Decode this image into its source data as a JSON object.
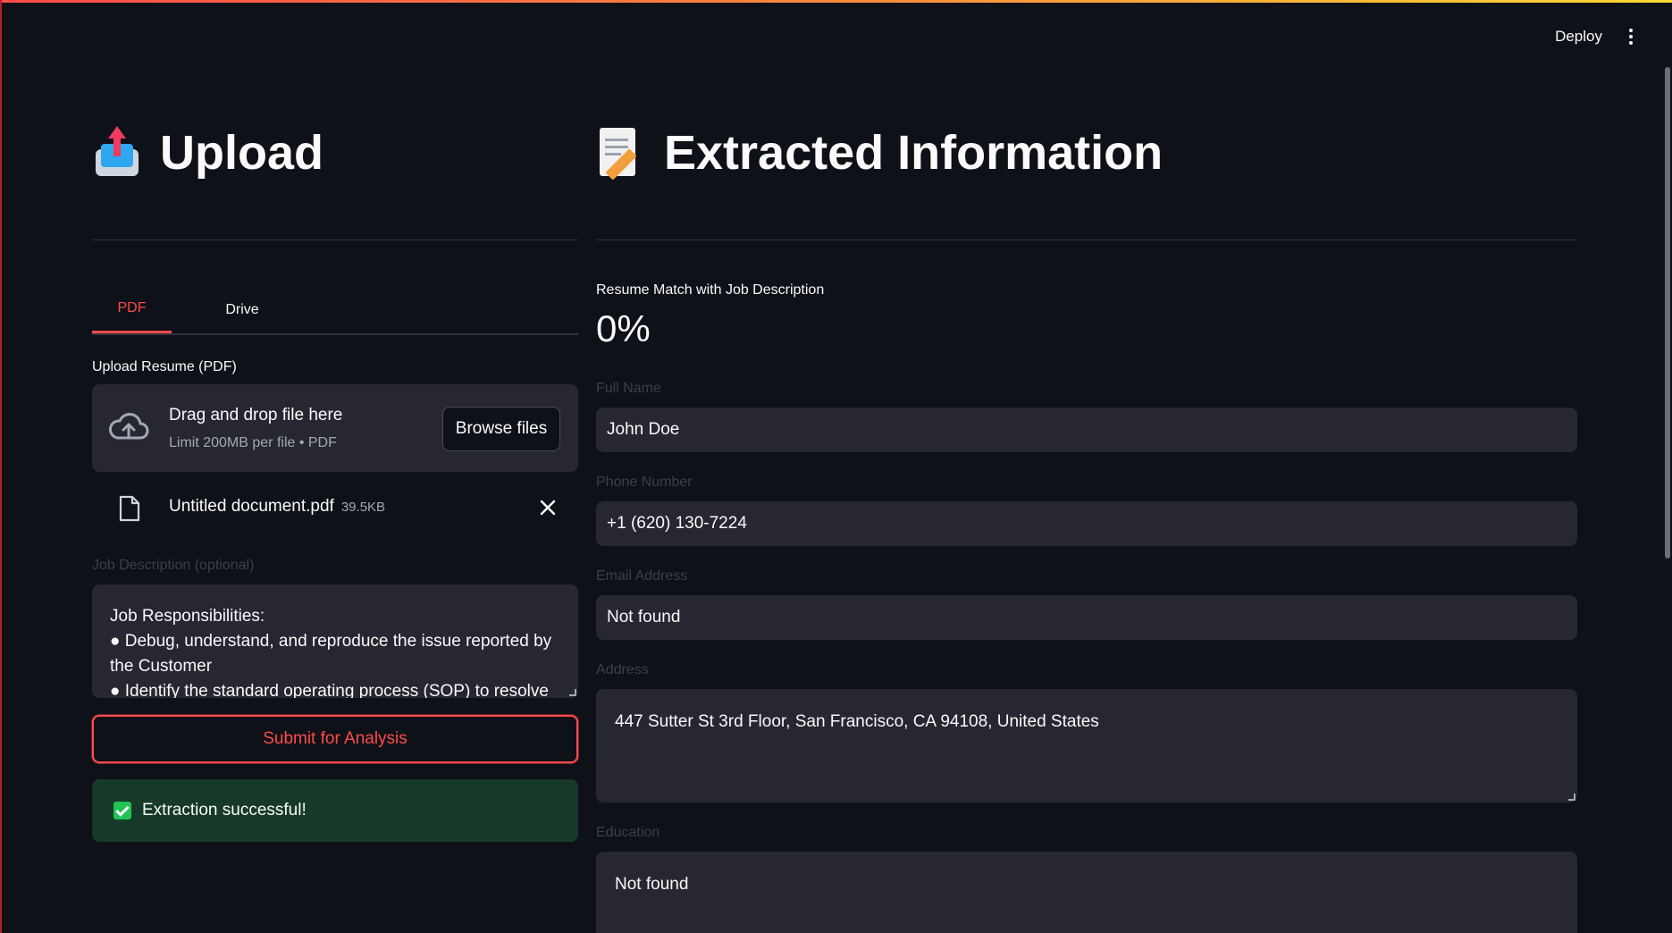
{
  "header": {
    "deploy_label": "Deploy"
  },
  "left": {
    "title": "Upload",
    "tabs": [
      {
        "label": "PDF",
        "active": true
      },
      {
        "label": "Drive",
        "active": false
      }
    ],
    "upload_label": "Upload Resume (PDF)",
    "dropzone": {
      "title": "Drag and drop file here",
      "subtitle": "Limit 200MB per file • PDF",
      "browse_label": "Browse files"
    },
    "file": {
      "name": "Untitled document.pdf",
      "size": "39.5KB"
    },
    "job_description_label": "Job Description (optional)",
    "job_description_text": "Job Responsibilities:\n● Debug, understand, and reproduce the issue reported by the Customer\n● Identify the standard operating process (SOP) to resolve",
    "submit_label": "Submit for Analysis",
    "success_message": "Extraction successful!"
  },
  "right": {
    "title": "Extracted Information",
    "metric": {
      "label": "Resume Match with Job Description",
      "value": "0%"
    },
    "fields": {
      "full_name": {
        "label": "Full Name",
        "value": "John Doe"
      },
      "phone": {
        "label": "Phone Number",
        "value": "+1 (620) 130-7224"
      },
      "email": {
        "label": "Email Address",
        "value": "Not found"
      },
      "address": {
        "label": "Address",
        "value": "447 Sutter St 3rd Floor, San Francisco, CA 94108, United States"
      },
      "education": {
        "label": "Education",
        "value": "Not found"
      }
    }
  },
  "colors": {
    "background": "#0e1117",
    "accent": "#ff4b4b",
    "input_bg": "#262730",
    "success_bg": "#173928"
  }
}
